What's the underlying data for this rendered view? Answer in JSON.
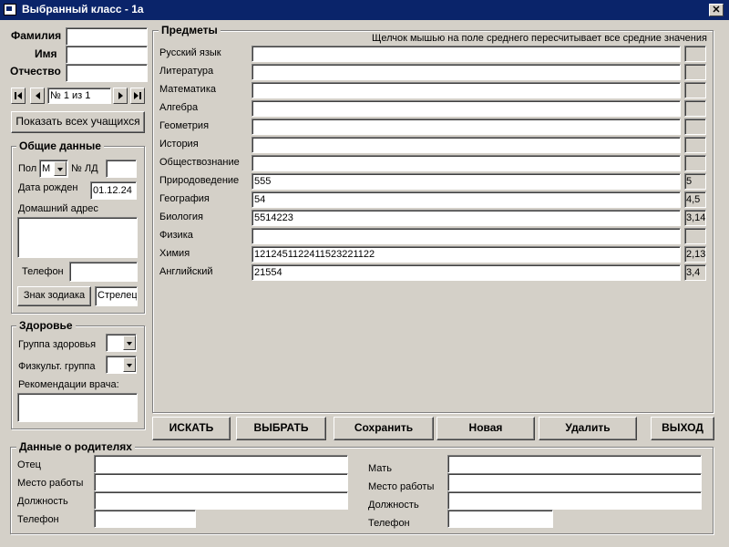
{
  "window": {
    "title": "Выбранный класс - 1а",
    "close_label": "✕"
  },
  "student": {
    "lastname_label": "Фамилия",
    "firstname_label": "Имя",
    "patronymic_label": "Отчество",
    "lastname": "",
    "firstname": "",
    "patronymic": ""
  },
  "navigator": {
    "record_text": "№ 1 из 1"
  },
  "show_all_button": "Показать всех учащихся",
  "general": {
    "title": "Общие данные",
    "gender_label": "Пол",
    "gender_value": "М",
    "ld_label": "№ ЛД",
    "ld_value": "",
    "birthdate_label": "Дата  рожден",
    "birthdate_value": "01.12.24",
    "address_label": "Домашний адрес",
    "address_value": "",
    "phone_label": "Телефон",
    "phone_value": "",
    "zodiac_button": "Знак зодиака",
    "zodiac_value": "Стрелец"
  },
  "health": {
    "title": "Здоровье",
    "group_label": "Группа здоровья",
    "group_value": "",
    "pe_label": "Физкульт. группа",
    "pe_value": "",
    "doctor_label": "Рекомендации врача:",
    "doctor_value": ""
  },
  "subjects": {
    "title": "Предметы",
    "hint": "Щелчок мышью на поле среднего пересчитывает все средние значения",
    "items": [
      {
        "name": "Русский язык",
        "grades": "",
        "avg": ""
      },
      {
        "name": "Литература",
        "grades": "",
        "avg": ""
      },
      {
        "name": "Математика",
        "grades": "",
        "avg": ""
      },
      {
        "name": "Алгебра",
        "grades": "",
        "avg": ""
      },
      {
        "name": "Геометрия",
        "grades": "",
        "avg": ""
      },
      {
        "name": "История",
        "grades": "",
        "avg": ""
      },
      {
        "name": "Обществознание",
        "grades": "",
        "avg": ""
      },
      {
        "name": "Природоведение",
        "grades": "555",
        "avg": "5"
      },
      {
        "name": "География",
        "grades": "54",
        "avg": "4,5"
      },
      {
        "name": "Биология",
        "grades": "5514223",
        "avg": "3,14"
      },
      {
        "name": "Физика",
        "grades": "",
        "avg": ""
      },
      {
        "name": "Химия",
        "grades": "1212451122411523221122",
        "avg": "2,13"
      },
      {
        "name": "Английский",
        "grades": "21554",
        "avg": "3,4"
      }
    ]
  },
  "actions": {
    "search": "ИСКАТЬ",
    "select": "ВЫБРАТЬ",
    "save": "Сохранить",
    "new": "Новая",
    "delete": "Удалить",
    "exit": "ВЫХОД"
  },
  "parents": {
    "title": "Данные о родителях",
    "father_label": "Отец",
    "father_work_label": "Место работы",
    "father_position_label": "Должность",
    "father_phone_label": "Телефон",
    "mother_label": "Мать",
    "mother_work_label": "Место работы",
    "mother_position_label": "Должность",
    "mother_phone_label": "Телефон",
    "father": "",
    "father_work": "",
    "father_position": "",
    "father_phone": "",
    "mother": "",
    "mother_work": "",
    "mother_position": "",
    "mother_phone": ""
  }
}
